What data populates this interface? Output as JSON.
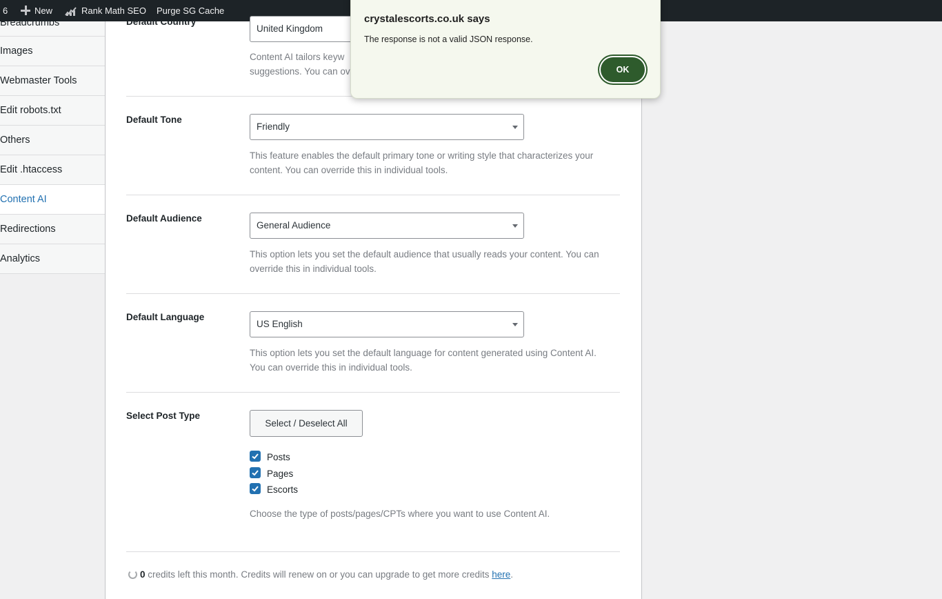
{
  "adminbar": {
    "count": "6",
    "new_label": "New",
    "rankmath_label": "Rank Math SEO",
    "purge_label": "Purge SG Cache"
  },
  "sidebar": {
    "items": [
      {
        "label": "Breadcrumbs"
      },
      {
        "label": "Images"
      },
      {
        "label": "Webmaster Tools"
      },
      {
        "label": "Edit robots.txt"
      },
      {
        "label": "Others"
      },
      {
        "label": "Edit .htaccess"
      },
      {
        "label": "Content AI",
        "active": true
      },
      {
        "label": "Redirections"
      },
      {
        "label": "Analytics"
      }
    ]
  },
  "settings": {
    "country": {
      "label": "Default Country",
      "value": "United Kingdom",
      "desc_line1": "Content AI tailors keyw",
      "desc_line2": "suggestions. You can ov"
    },
    "tone": {
      "label": "Default Tone",
      "value": "Friendly",
      "desc_line1": "This feature enables the default primary tone or writing style that characterizes your",
      "desc_line2": "content. You can override this in individual tools."
    },
    "audience": {
      "label": "Default Audience",
      "value": "General Audience",
      "desc_line1": "This option lets you set the default audience that usually reads your content. You can",
      "desc_line2": "override this in individual tools."
    },
    "language": {
      "label": "Default Language",
      "value": "US English",
      "desc_line1": "This option lets you set the default language for content generated using Content AI.",
      "desc_line2": "You can override this in individual tools."
    },
    "post_type": {
      "label": "Select Post Type",
      "button_label": "Select / Deselect All",
      "options": [
        {
          "label": "Posts",
          "checked": true
        },
        {
          "label": "Pages",
          "checked": true
        },
        {
          "label": "Escorts",
          "checked": true
        }
      ],
      "desc": "Choose the type of posts/pages/CPTs where you want to use Content AI."
    }
  },
  "credits": {
    "count": "0",
    "text": " credits left this month. Credits will renew on or you can upgrade to get more credits ",
    "link_label": "here",
    "suffix": "."
  },
  "dialog": {
    "title": "crystalescorts.co.uk says",
    "message": "The response is not a valid JSON response.",
    "ok_label": "OK"
  },
  "colors": {
    "accent": "#2271b1",
    "dialog_button": "#2e5b2c",
    "adminbar": "#1d2327"
  }
}
